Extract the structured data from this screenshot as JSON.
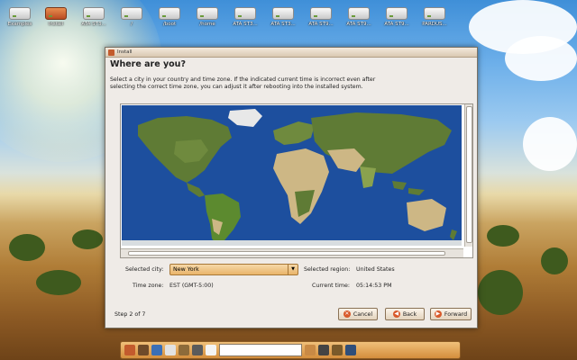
{
  "desktop": {
    "icons": [
      {
        "label": "Examples",
        "kind": "drive"
      },
      {
        "label": "Install",
        "kind": "installer"
      },
      {
        "label": "ATA ST3...",
        "kind": "drive"
      },
      {
        "label": "/",
        "kind": "drive"
      },
      {
        "label": "/boot",
        "kind": "drive"
      },
      {
        "label": "/home",
        "kind": "drive"
      },
      {
        "label": "ATA ST3...",
        "kind": "drive"
      },
      {
        "label": "ATA ST3...",
        "kind": "drive"
      },
      {
        "label": "ATA ST9...",
        "kind": "drive"
      },
      {
        "label": "ATA ST9...",
        "kind": "drive"
      },
      {
        "label": "ATA ST9...",
        "kind": "drive"
      },
      {
        "label": "PARDUS...",
        "kind": "drive"
      }
    ]
  },
  "window": {
    "title": "Install",
    "heading": "Where are you?",
    "description": "Select a city in your country and time zone. If the indicated current time is incorrect even after selecting the correct time zone, you can adjust it after rebooting into the installed system.",
    "selected_city_label": "Selected city:",
    "selected_city": "New York",
    "selected_region_label": "Selected region:",
    "selected_region": "United States",
    "timezone_label": "Time zone:",
    "timezone": "EST (GMT-5:00)",
    "current_time_label": "Current time:",
    "current_time": "05:14:53 PM",
    "step": "Step 2 of 7",
    "buttons": {
      "cancel": "Cancel",
      "back": "Back",
      "forward": "Forward"
    }
  },
  "colors": {
    "ocean": "#1d4f9e",
    "land_green": "#5f7b35",
    "land_desert": "#cdb785",
    "button_accent": "#d8592a"
  }
}
